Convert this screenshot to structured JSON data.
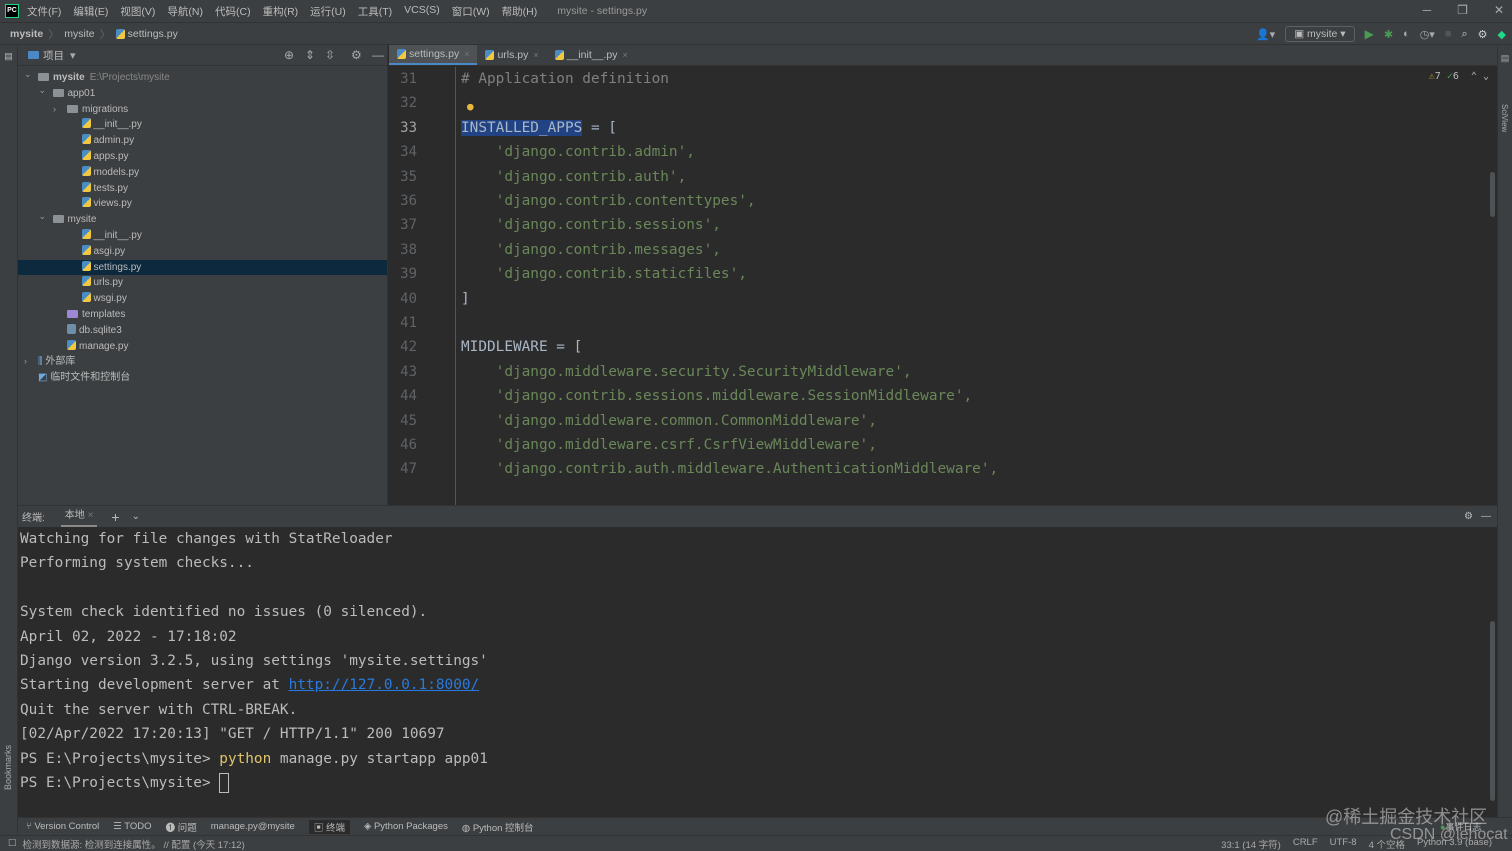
{
  "titlebar": {
    "logo": "PC",
    "menus": [
      "文件(F)",
      "编辑(E)",
      "视图(V)",
      "导航(N)",
      "代码(C)",
      "重构(R)",
      "运行(U)",
      "工具(T)",
      "VCS(S)",
      "窗口(W)",
      "帮助(H)"
    ],
    "title": "mysite - settings.py"
  },
  "breadcrumb": [
    "mysite",
    "mysite",
    "settings.py"
  ],
  "run_config": "mysite",
  "project": {
    "header": "项目",
    "tree": [
      {
        "label": "mysite",
        "extra": "E:\\Projects\\mysite",
        "depth": 0,
        "type": "folder",
        "arrow": "open"
      },
      {
        "label": "app01",
        "depth": 1,
        "type": "folder",
        "arrow": "open"
      },
      {
        "label": "migrations",
        "depth": 2,
        "type": "folder",
        "arrow": "closed"
      },
      {
        "label": "__init__.py",
        "depth": 3,
        "type": "py"
      },
      {
        "label": "admin.py",
        "depth": 3,
        "type": "py"
      },
      {
        "label": "apps.py",
        "depth": 3,
        "type": "py"
      },
      {
        "label": "models.py",
        "depth": 3,
        "type": "py"
      },
      {
        "label": "tests.py",
        "depth": 3,
        "type": "py"
      },
      {
        "label": "views.py",
        "depth": 3,
        "type": "py"
      },
      {
        "label": "mysite",
        "depth": 1,
        "type": "folder",
        "arrow": "open"
      },
      {
        "label": "__init__.py",
        "depth": 3,
        "type": "py"
      },
      {
        "label": "asgi.py",
        "depth": 3,
        "type": "py"
      },
      {
        "label": "settings.py",
        "depth": 3,
        "type": "py",
        "selected": true
      },
      {
        "label": "urls.py",
        "depth": 3,
        "type": "py"
      },
      {
        "label": "wsgi.py",
        "depth": 3,
        "type": "py"
      },
      {
        "label": "templates",
        "depth": 2,
        "type": "folder-purple"
      },
      {
        "label": "db.sqlite3",
        "depth": 2,
        "type": "db"
      },
      {
        "label": "manage.py",
        "depth": 2,
        "type": "py"
      },
      {
        "label": "外部库",
        "depth": 0,
        "type": "lib",
        "arrow": "closed"
      },
      {
        "label": "临时文件和控制台",
        "depth": 0,
        "type": "scratch"
      }
    ]
  },
  "editor": {
    "tabs": [
      {
        "label": "settings.py",
        "active": true
      },
      {
        "label": "urls.py"
      },
      {
        "label": "__init__.py"
      }
    ],
    "inspections": {
      "warnings": "7",
      "typos": "6"
    },
    "current_line": 33,
    "lines": [
      {
        "n": "31",
        "t": "# Application definition",
        "k": "cm"
      },
      {
        "n": "32",
        "t": ""
      },
      {
        "n": "33",
        "pre": "INSTALLED_APPS",
        "t": " = ["
      },
      {
        "n": "34",
        "t": "    'django.contrib.admin',",
        "k": "str"
      },
      {
        "n": "35",
        "t": "    'django.contrib.auth',",
        "k": "str"
      },
      {
        "n": "36",
        "t": "    'django.contrib.contenttypes',",
        "k": "str"
      },
      {
        "n": "37",
        "t": "    'django.contrib.sessions',",
        "k": "str"
      },
      {
        "n": "38",
        "t": "    'django.contrib.messages',",
        "k": "str"
      },
      {
        "n": "39",
        "t": "    'django.contrib.staticfiles',",
        "k": "str"
      },
      {
        "n": "40",
        "t": "]"
      },
      {
        "n": "41",
        "t": ""
      },
      {
        "n": "42",
        "t": "MIDDLEWARE = ["
      },
      {
        "n": "43",
        "t": "    'django.middleware.security.SecurityMiddleware',",
        "k": "str"
      },
      {
        "n": "44",
        "t": "    'django.contrib.sessions.middleware.SessionMiddleware',",
        "k": "str"
      },
      {
        "n": "45",
        "t": "    'django.middleware.common.CommonMiddleware',",
        "k": "str"
      },
      {
        "n": "46",
        "t": "    'django.middleware.csrf.CsrfViewMiddleware',",
        "k": "str"
      },
      {
        "n": "47",
        "t": "    'django.contrib.auth.middleware.AuthenticationMiddleware',",
        "k": "str"
      }
    ]
  },
  "terminal": {
    "label": "终端:",
    "tab": "本地",
    "lines": [
      "Watching for file changes with StatReloader",
      "Performing system checks...",
      "",
      "System check identified no issues (0 silenced).",
      "April 02, 2022 - 17:18:02",
      "Django version 3.2.5, using settings 'mysite.settings'",
      "Starting development server at ",
      "Quit the server with CTRL-BREAK.",
      "[02/Apr/2022 17:20:13] \"GET / HTTP/1.1\" 200 10697",
      "PS E:\\Projects\\mysite> ",
      "PS E:\\Projects\\mysite> "
    ],
    "link": "http://127.0.0.1:8000/",
    "cmd_kw": "python",
    "cmd_rest": " manage.py startapp app01"
  },
  "toolbar": [
    "Version Control",
    "TODO",
    "问题",
    "manage.py@mysite",
    "终端",
    "Python Packages",
    "Python 控制台"
  ],
  "status": {
    "message": "检测到数据源: 检测到连接属性。 // 配置 (今天 17:12)",
    "position": "33:1 (14 字符)",
    "line_sep": "CRLF",
    "encoding": "UTF-8",
    "indent": "4 个空格",
    "interpreter": "Python 3.9 (base)",
    "event_log": "事件日志"
  },
  "watermarks": [
    "@稀土掘金技术社区",
    "CSDN @lehocat"
  ],
  "colors": {
    "editor_bg": "#2b2b2b",
    "panel_bg": "#3c3f41",
    "selection": "#0d293e",
    "string": "#6a8759",
    "link": "#287bde"
  }
}
